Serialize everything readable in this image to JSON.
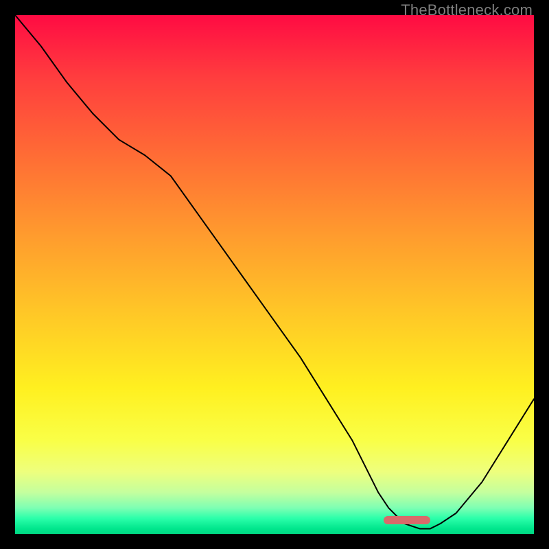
{
  "watermark": {
    "text": "TheBottleneck.com"
  },
  "marker": {
    "left_pct": 71,
    "width_pct": 9,
    "top_pct": 96.5,
    "height_pct": 1.7
  },
  "chart_data": {
    "type": "line",
    "title": "",
    "xlabel": "",
    "ylabel": "",
    "xlim": [
      0,
      100
    ],
    "ylim": [
      0,
      100
    ],
    "grid": false,
    "legend": false,
    "series": [
      {
        "name": "bottleneck-curve",
        "x": [
          0,
          5,
          10,
          15,
          20,
          25,
          30,
          35,
          40,
          45,
          50,
          55,
          60,
          65,
          68,
          70,
          72,
          75,
          78,
          80,
          82,
          85,
          90,
          95,
          100
        ],
        "values": [
          100,
          94,
          87,
          81,
          76,
          73,
          69,
          62,
          55,
          48,
          41,
          34,
          26,
          18,
          12,
          8,
          5,
          2,
          1,
          1,
          2,
          4,
          10,
          18,
          26
        ]
      }
    ],
    "optimal_range_pct": [
      71,
      80
    ]
  }
}
